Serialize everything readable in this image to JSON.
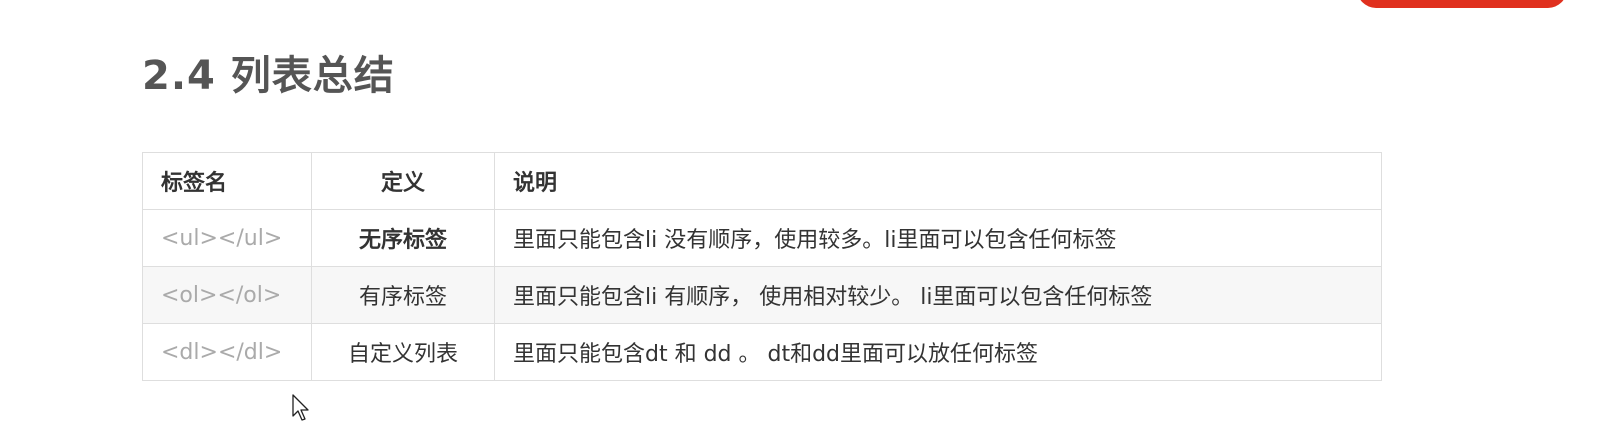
{
  "title": "2.4 列表总结",
  "table": {
    "headers": [
      "标签名",
      "定义",
      "说明"
    ],
    "rows": [
      {
        "tag": "<ul></ul>",
        "definition": "无序标签",
        "description": "里面只能包含li    没有顺序，使用较多。li里面可以包含任何标签"
      },
      {
        "tag": "<ol></ol>",
        "definition": "有序标签",
        "description": "里面只能包含li    有顺序， 使用相对较少。 li里面可以包含任何标签"
      },
      {
        "tag": "<dl></dl>",
        "definition": "自定义列表",
        "description": "里面只能包含dt 和 dd 。 dt和dd里面可以放任何标签"
      }
    ]
  },
  "colors": {
    "accent_button": "#e0301e",
    "title_text": "#555555",
    "tag_text": "#aaaaaa",
    "border": "#dedede",
    "alt_row": "#f7f7f7"
  }
}
